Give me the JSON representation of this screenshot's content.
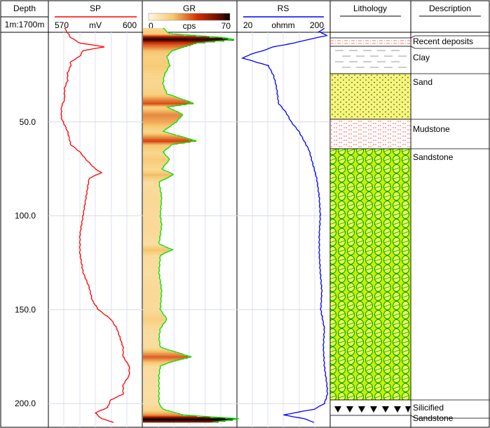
{
  "header": {
    "depth_title": "Depth",
    "depth_scale": "1m:1700m",
    "sp": {
      "title": "SP",
      "min": "570",
      "unit": "mV",
      "max": "600",
      "color": "#ff0000"
    },
    "gr": {
      "title": "GR",
      "min": "0",
      "unit": "cps",
      "max": "70"
    },
    "rs": {
      "title": "RS",
      "min": "20",
      "unit": "ohmm",
      "max": "200",
      "color": "#0000ff"
    },
    "lithology_title": "Lithology",
    "description_title": "Description"
  },
  "depth_ticks": [
    "50.0",
    "100.0",
    "150.0",
    "200.0"
  ],
  "layers": [
    {
      "name": "Recent deposits",
      "pattern": "recent"
    },
    {
      "name": "Clay",
      "pattern": "clay"
    },
    {
      "name": "Sand",
      "pattern": "sand"
    },
    {
      "name": "Mudstone",
      "pattern": "mudstone"
    },
    {
      "name": "Sandstone",
      "pattern": "sandstone"
    },
    {
      "name": "Silicified\nSandstone",
      "pattern": "silicified"
    }
  ],
  "chart_data": {
    "type": "line",
    "depth_range": [
      0,
      210
    ],
    "depth_unit": "m",
    "series": [
      {
        "name": "SP",
        "unit": "mV",
        "range": [
          570,
          600
        ],
        "color": "#ff0000",
        "depth": [
          0,
          5,
          8,
          10,
          12,
          15,
          18,
          20,
          24,
          28,
          32,
          38,
          42,
          48,
          55,
          62,
          66,
          70,
          75,
          77,
          80,
          90,
          100,
          110,
          115,
          120,
          130,
          138,
          145,
          150,
          155,
          160,
          165,
          170,
          175,
          180,
          185,
          190,
          195,
          198,
          202,
          205,
          208,
          210
        ],
        "values": [
          575,
          577,
          580,
          588,
          581,
          580,
          577,
          577,
          576,
          576,
          575,
          575,
          574,
          574,
          576,
          577,
          580,
          582,
          585,
          587,
          583,
          582,
          581,
          580,
          580,
          580,
          581,
          583,
          584,
          586,
          590,
          592,
          593,
          594,
          594,
          596,
          596,
          594,
          594,
          590,
          589,
          585,
          587,
          591
        ]
      },
      {
        "name": "GR",
        "unit": "cps",
        "range": [
          0,
          70
        ],
        "color": "#00ff00",
        "depth": [
          0,
          3,
          5,
          6,
          8,
          12,
          15,
          20,
          25,
          30,
          35,
          40,
          42,
          46,
          50,
          55,
          60,
          62,
          66,
          70,
          75,
          78,
          82,
          90,
          100,
          105,
          115,
          118,
          121,
          130,
          140,
          150,
          155,
          160,
          165,
          170,
          175,
          178,
          180,
          185,
          190,
          195,
          200,
          203,
          206,
          208,
          210
        ],
        "values": [
          15,
          20,
          60,
          68,
          40,
          22,
          18,
          20,
          16,
          15,
          18,
          38,
          18,
          30,
          25,
          15,
          40,
          22,
          15,
          20,
          14,
          23,
          12,
          14,
          13,
          14,
          12,
          22,
          13,
          12,
          14,
          13,
          18,
          13,
          12,
          13,
          36,
          20,
          13,
          12,
          12,
          12,
          12,
          15,
          30,
          72,
          52
        ]
      },
      {
        "name": "RS",
        "unit": "ohmm",
        "range": [
          20,
          200
        ],
        "color": "#0000ff",
        "depth": [
          0,
          2,
          4,
          6,
          8,
          10,
          12,
          14,
          16,
          18,
          20,
          25,
          30,
          35,
          40,
          45,
          50,
          55,
          60,
          65,
          70,
          75,
          80,
          90,
          100,
          110,
          120,
          130,
          140,
          150,
          160,
          170,
          180,
          190,
          195,
          200,
          203,
          206,
          208,
          210
        ],
        "values": [
          190,
          180,
          195,
          160,
          130,
          90,
          70,
          45,
          30,
          55,
          80,
          90,
          95,
          98,
          100,
          115,
          125,
          140,
          150,
          160,
          165,
          170,
          175,
          180,
          182,
          180,
          180,
          182,
          185,
          183,
          190,
          188,
          190,
          195,
          196,
          190,
          170,
          110,
          150,
          170
        ]
      }
    ]
  }
}
